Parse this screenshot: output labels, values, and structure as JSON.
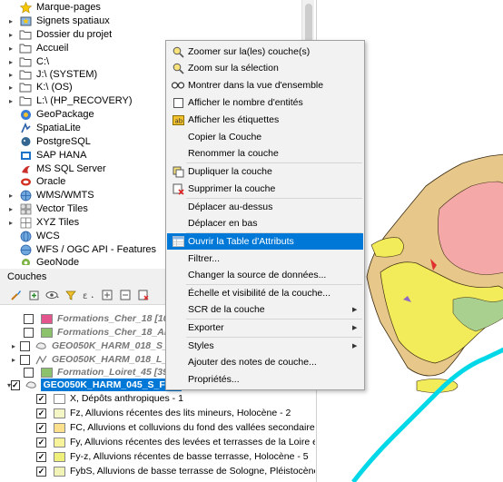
{
  "browser": {
    "items": [
      {
        "label": "Marque-pages",
        "icon": "star-icon",
        "arrow": ""
      },
      {
        "label": "Signets spatiaux",
        "icon": "spatial-bookmark-icon",
        "arrow": "▸"
      },
      {
        "label": "Dossier du projet",
        "icon": "folder-icon",
        "arrow": "▸"
      },
      {
        "label": "Accueil",
        "icon": "folder-icon",
        "arrow": "▸"
      },
      {
        "label": "C:\\",
        "icon": "folder-icon",
        "arrow": "▸"
      },
      {
        "label": "J:\\ (SYSTEM)",
        "icon": "folder-icon",
        "arrow": "▸"
      },
      {
        "label": "K:\\ (OS)",
        "icon": "folder-icon",
        "arrow": "▸"
      },
      {
        "label": "L:\\ (HP_RECOVERY)",
        "icon": "folder-icon",
        "arrow": "▸"
      },
      {
        "label": "GeoPackage",
        "icon": "geopackage-icon",
        "arrow": ""
      },
      {
        "label": "SpatiaLite",
        "icon": "spatialite-icon",
        "arrow": ""
      },
      {
        "label": "PostgreSQL",
        "icon": "postgresql-icon",
        "arrow": ""
      },
      {
        "label": "SAP HANA",
        "icon": "sap-hana-icon",
        "arrow": ""
      },
      {
        "label": "MS SQL Server",
        "icon": "mssql-icon",
        "arrow": ""
      },
      {
        "label": "Oracle",
        "icon": "oracle-icon",
        "arrow": ""
      },
      {
        "label": "WMS/WMTS",
        "icon": "wms-icon",
        "arrow": "▸"
      },
      {
        "label": "Vector Tiles",
        "icon": "vector-tiles-icon",
        "arrow": "▸"
      },
      {
        "label": "XYZ Tiles",
        "icon": "xyz-tiles-icon",
        "arrow": "▸"
      },
      {
        "label": "WCS",
        "icon": "wcs-icon",
        "arrow": ""
      },
      {
        "label": "WFS / OGC API - Features",
        "icon": "wfs-icon",
        "arrow": ""
      },
      {
        "label": "GeoNode",
        "icon": "geonode-icon",
        "arrow": ""
      }
    ]
  },
  "layers": {
    "title": "Couches",
    "rows": [
      {
        "label": "Formations_Cher_18 [1046]",
        "style": "italic",
        "swatch": "#e3558c",
        "checked": false
      },
      {
        "label": "Formations_Cher_18_Allier",
        "style": "italic",
        "swatch": "#8cc26b",
        "checked": false
      },
      {
        "label": "GEO050K_HARM_018_S_FGE",
        "style": "italic",
        "swatch": "",
        "checked": false
      },
      {
        "label": "GEO050K_HARM_018_L_FGE",
        "style": "italic",
        "swatch": "",
        "checked": false
      },
      {
        "label": "Formation_Loiret_45 [391]",
        "style": "italic",
        "swatch": "#8cc26b",
        "checked": false
      },
      {
        "label": "GEO050K_HARM_045_S_FGE",
        "style": "selected",
        "swatch": "",
        "checked": true
      },
      {
        "label": "X, Dépôts anthropiques - 1",
        "style": "class",
        "swatch": "#ffffff",
        "checked": true
      },
      {
        "label": "Fz, Alluvions récentes des lits mineurs, Holocène - 2",
        "style": "class",
        "swatch": "#f5f6c6",
        "checked": true
      },
      {
        "label": "FC, Alluvions et colluvions du fond des vallées secondaires, H",
        "style": "class",
        "swatch": "#fce08c",
        "checked": true
      },
      {
        "label": "Fy, Alluvions récentes des levées et terrasses de la Loire et de",
        "style": "class",
        "swatch": "#f7f39a",
        "checked": true
      },
      {
        "label": "Fy-z, Alluvions récentes de basse terrasse,  Holocène - 5",
        "style": "class",
        "swatch": "#eef07a",
        "checked": true
      },
      {
        "label": "FybS, Alluvions de basse terrasse de Sologne, Pléistocène (W",
        "style": "class",
        "swatch": "#f0f3b5",
        "checked": true
      }
    ]
  },
  "context_menu": {
    "items": [
      {
        "label": "Zoomer sur la(les) couche(s)",
        "icon": "zoom-layer-icon",
        "submenu": false
      },
      {
        "label": "Zoom sur la sélection",
        "icon": "zoom-selection-icon",
        "submenu": false
      },
      {
        "label": "Montrer dans la vue d'ensemble",
        "icon": "overview-icon",
        "submenu": false
      },
      {
        "label": "Afficher le nombre d'entités",
        "icon": "checkbox-icon",
        "submenu": false
      },
      {
        "label": "Afficher les étiquettes",
        "icon": "labels-icon",
        "submenu": false
      },
      {
        "label": "Copier la Couche",
        "icon": "",
        "submenu": false
      },
      {
        "label": "Renommer la couche",
        "icon": "",
        "submenu": false
      },
      {
        "label": "Dupliquer la couche",
        "icon": "duplicate-icon",
        "submenu": false
      },
      {
        "label": "Supprimer la couche",
        "icon": "remove-layer-icon",
        "submenu": false
      },
      {
        "label": "Déplacer au-dessus",
        "icon": "",
        "submenu": false
      },
      {
        "label": "Déplacer en bas",
        "icon": "",
        "submenu": false
      },
      {
        "label": "Ouvrir la Table d'Attributs",
        "icon": "attribute-table-icon",
        "submenu": false
      },
      {
        "label": "Filtrer...",
        "icon": "",
        "submenu": false
      },
      {
        "label": "Changer la source de données...",
        "icon": "",
        "submenu": false
      },
      {
        "label": "Échelle et visibilité de la couche...",
        "icon": "",
        "submenu": false
      },
      {
        "label": "SCR de la couche",
        "icon": "",
        "submenu": true
      },
      {
        "label": "Exporter",
        "icon": "",
        "submenu": true
      },
      {
        "label": "Styles",
        "icon": "",
        "submenu": true
      },
      {
        "label": "Ajouter des notes de couche...",
        "icon": "",
        "submenu": false
      },
      {
        "label": "Propriétés...",
        "icon": "",
        "submenu": false
      }
    ]
  },
  "colors": {
    "selection": "#0078d7",
    "river": "#00d8e8",
    "map_yellow": "#f2ec5a",
    "map_tan": "#e7c88a",
    "map_pink": "#f4a8a8"
  }
}
